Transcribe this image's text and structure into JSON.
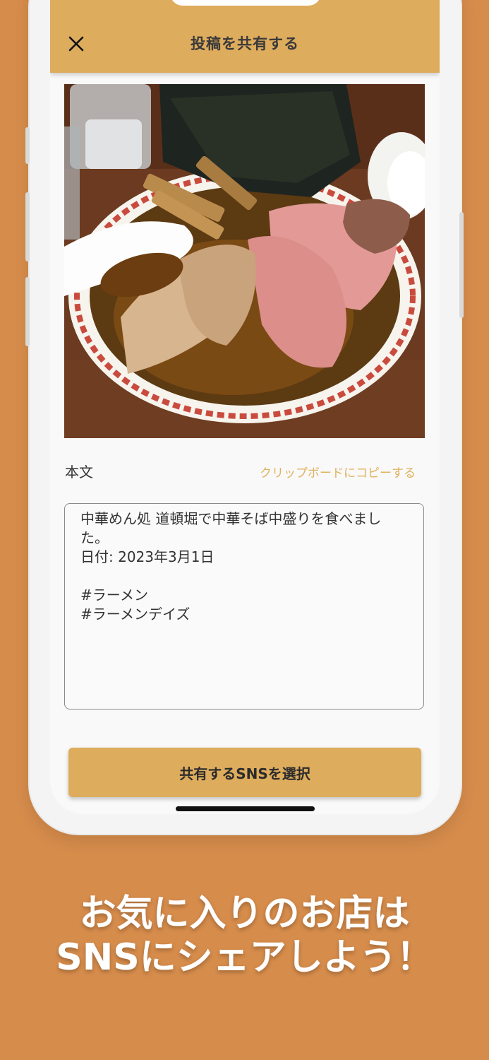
{
  "header": {
    "title": "投稿を共有する",
    "close_icon": "close-icon"
  },
  "post": {
    "body_label": "本文",
    "copy_label": "クリップボードにコピーする",
    "body_text": "中華めん処 道頓堀で中華そば中盛りを食べました。\n日付: 2023年3月1日\n\n#ラーメン\n#ラーメンデイズ"
  },
  "share_button": {
    "label": "共有するSNSを選択"
  },
  "promo": {
    "line1": "お気に入りのお店は",
    "line2": "SNSにシェアしよう！"
  },
  "colors": {
    "background": "#D68C4B",
    "accent": "#DEAC5D",
    "link": "#E0B35F"
  }
}
